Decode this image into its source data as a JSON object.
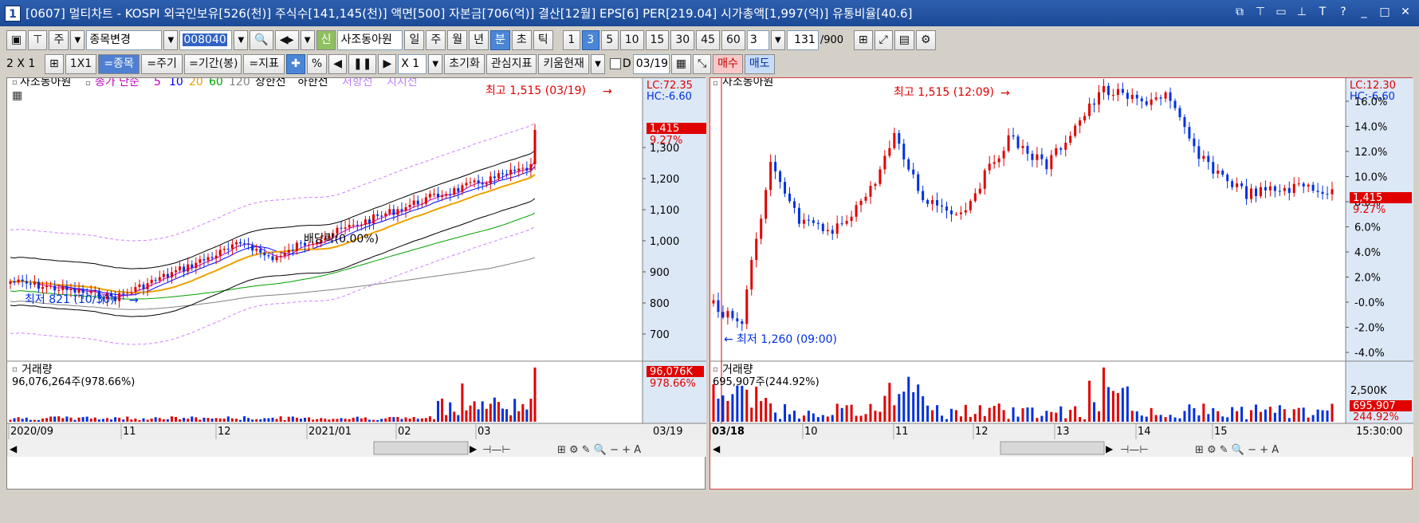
{
  "window": {
    "number": "1",
    "title": "[0607] 멀티차트 - KOSPI 외국인보유[526(천)] 주식수[141,145(천)] 액면[500] 자본금[706(억)] 결산[12월] EPS[6] PER[219.04] 시가총액[1,997(억)] 유통비율[40.6]"
  },
  "toolbar1": {
    "type_label": "주",
    "change_label": "종목변경",
    "code_value": "008040",
    "new_badge": "신",
    "stock_name": "사조동아원",
    "periods": [
      "일",
      "주",
      "월",
      "년",
      "분",
      "초",
      "틱"
    ],
    "intervals": [
      "1",
      "3",
      "5",
      "10",
      "15",
      "30",
      "45",
      "60"
    ],
    "interval_value": "3",
    "count_value": "131",
    "count_total": "/900"
  },
  "toolbar2": {
    "layout_label": "2 X 1",
    "one_label": "1X1",
    "stock_btn": "=종목",
    "cycle_btn": "=주기",
    "period_btn": "=기간(봉)",
    "indicator_btn": "=지표",
    "percent": "%",
    "zoom": "X 1",
    "reset_btn": "초기화",
    "watch_btn": "관심지표",
    "kiwoom_btn": "키움현재",
    "d_label": "D",
    "date_value": "03/19",
    "buy_btn": "매수",
    "sell_btn": "매도"
  },
  "left_chart": {
    "stock_name": "사조동아원",
    "legend_prefix": "종가 단순",
    "ma": [
      {
        "label": "5",
        "color": "#c000c0"
      },
      {
        "label": "10",
        "color": "#0000ff"
      },
      {
        "label": "20",
        "color": "#f0a000"
      },
      {
        "label": "60",
        "color": "#00a000"
      },
      {
        "label": "120",
        "color": "#808080"
      }
    ],
    "upper_label": "상한선",
    "lower_label": "하한선",
    "resist_label": "저항선",
    "support_label": "지지선",
    "lc": "LC:72.35",
    "hc": "HC:-6.60",
    "price_tag": "1,415",
    "pct_tag": "9.27%",
    "high_label": "최고 1,515 (03/19)",
    "low_label": "최저 821 (10/30)",
    "dividend_label": "배당락(0.00%)",
    "yaxis": [
      "1,300",
      "1,200",
      "1,100",
      "1,000",
      "900",
      "800",
      "700"
    ],
    "volume_title": "거래량",
    "volume_value": "96,076,264주(978.66%)",
    "volume_tag": "96,076K",
    "volume_pct": "978.66%",
    "xaxis": [
      "2020/09",
      "11",
      "12",
      "2021/01",
      "02",
      "03"
    ],
    "x_end": "03/19"
  },
  "right_chart": {
    "stock_name": "사조동아원",
    "lc": "LC:12.30",
    "hc": "HC:-6.60",
    "price_tag": "1,415",
    "pct_tag": "9.27%",
    "high_label": "최고 1,515 (12:09)",
    "low_label": "최저 1,260 (09:00)",
    "yaxis": [
      "16.0%",
      "14.0%",
      "12.0%",
      "10.0%",
      "8.0%",
      "6.0%",
      "4.0%",
      "2.0%",
      "-0.0%",
      "-2.0%",
      "-4.0%"
    ],
    "volume_title": "거래량",
    "volume_value": "695,907주(244.92%)",
    "volume_axis": "2,500K",
    "volume_tag": "695,907",
    "volume_pct": "244.92%",
    "xaxis": [
      "03/18",
      "10",
      "11",
      "12",
      "13",
      "14",
      "15"
    ],
    "x_end": "15:30:00"
  },
  "colors": {
    "up": "#e00000",
    "down": "#0030e0",
    "title_bg": "#1b4a96"
  }
}
